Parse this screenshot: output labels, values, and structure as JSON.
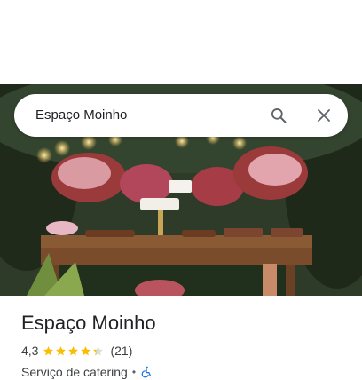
{
  "search": {
    "query": "Espaço Moinho"
  },
  "place": {
    "name": "Espaço Moinho",
    "rating": "4,3",
    "stars": 4.3,
    "review_count": "(21)",
    "category": "Serviço de catering",
    "separator": "•"
  },
  "icons": {
    "search": "search-icon",
    "close": "close-icon",
    "accessibility": "wheelchair-icon",
    "star": "star-icon"
  },
  "colors": {
    "star": "#fbbc04",
    "star_empty": "#dadce0",
    "accessibility": "#1a73e8",
    "text_primary": "#202124",
    "text_secondary": "#3c4043"
  }
}
